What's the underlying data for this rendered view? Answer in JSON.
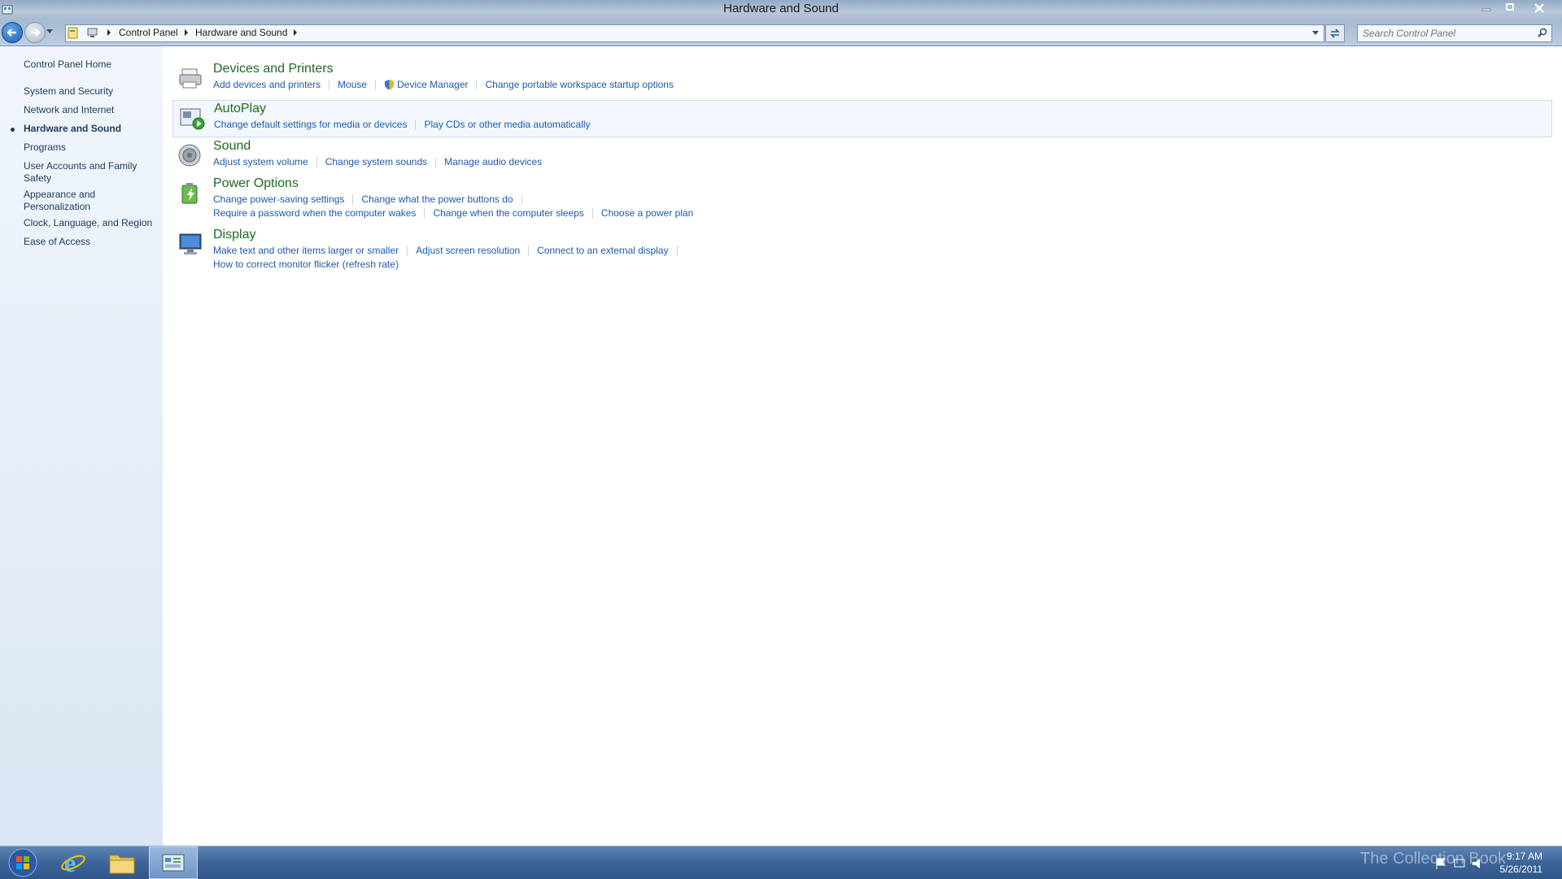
{
  "window": {
    "title": "Hardware and Sound"
  },
  "address": {
    "crumbs": [
      "Control Panel",
      "Hardware and Sound"
    ]
  },
  "search": {
    "placeholder": "Search Control Panel"
  },
  "sidebar": {
    "home": "Control Panel Home",
    "items": [
      {
        "label": "System and Security"
      },
      {
        "label": "Network and Internet"
      },
      {
        "label": "Hardware and Sound",
        "active": true
      },
      {
        "label": "Programs"
      },
      {
        "label": "User Accounts and Family Safety"
      },
      {
        "label": "Appearance and Personalization"
      },
      {
        "label": "Clock, Language, and Region"
      },
      {
        "label": "Ease of Access"
      }
    ]
  },
  "categories": [
    {
      "title": "Devices and Printers",
      "icon": "printer-icon",
      "links": [
        "Add devices and printers",
        "Mouse",
        "Device Manager",
        "Change portable workspace startup options"
      ]
    },
    {
      "title": "AutoPlay",
      "icon": "autoplay-icon",
      "links": [
        "Change default settings for media or devices",
        "Play CDs or other media automatically"
      ]
    },
    {
      "title": "Sound",
      "icon": "speaker-icon",
      "links": [
        "Adjust system volume",
        "Change system sounds",
        "Manage audio devices"
      ]
    },
    {
      "title": "Power Options",
      "icon": "battery-icon",
      "links": [
        "Change power-saving settings",
        "Change what the power buttons do"
      ],
      "links2": [
        "Require a password when the computer wakes",
        "Change when the computer sleeps",
        "Choose a power plan"
      ]
    },
    {
      "title": "Display",
      "icon": "monitor-icon",
      "links": [
        "Make text and other items larger or smaller",
        "Adjust screen resolution",
        "Connect to an external display"
      ],
      "links2": [
        "How to correct monitor flicker (refresh rate)"
      ]
    }
  ],
  "taskbar": {
    "clock_time": "9:17 AM",
    "clock_date": "5/26/2011",
    "watermark": "The Collection Book"
  },
  "colors": {
    "link": "#1e5aa8",
    "category_title": "#1e6b1e",
    "sidebar_text": "#1e395b"
  }
}
